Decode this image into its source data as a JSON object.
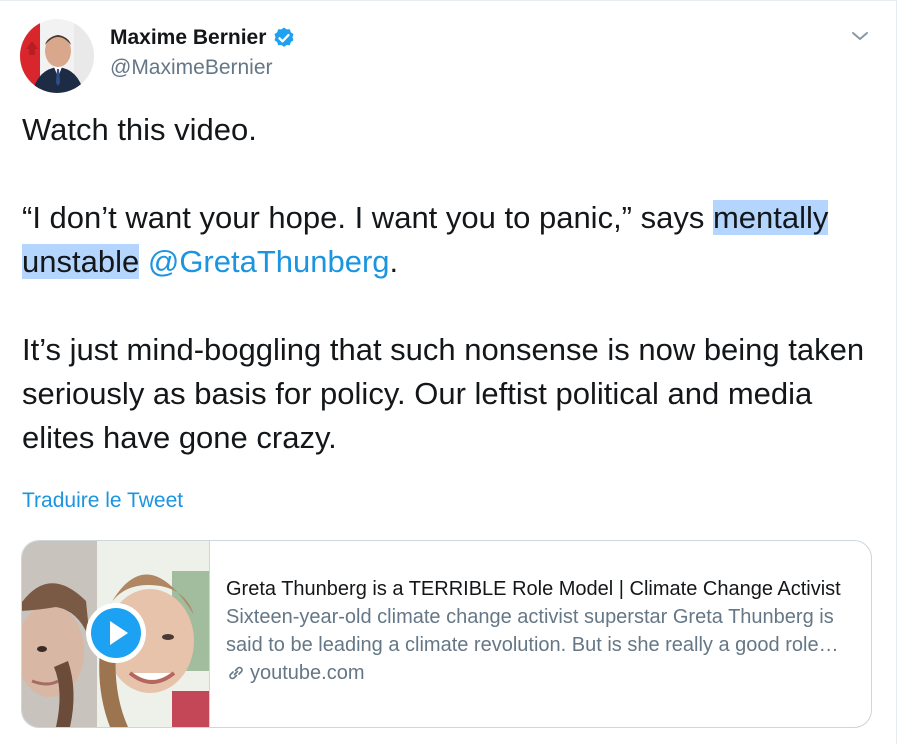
{
  "author": {
    "display_name": "Maxime Bernier",
    "handle": "@MaximeBernier",
    "verified_icon": "verified-badge-icon",
    "menu_icon": "chevron-down-icon"
  },
  "tweet": {
    "line1": "Watch this video.",
    "quote_start": "“I don’t want your hope. I want you to panic,” says ",
    "highlighted": "mentally unstable",
    "space": " ",
    "mention": "@GretaThunberg",
    "quote_end": ".",
    "para3": "It’s just mind-boggling that such nonsense is now being taken seriously as basis for policy. Our leftist political and media elites have gone crazy."
  },
  "translate_label": "Traduire le Tweet",
  "card": {
    "title": "Greta Thunberg is a TERRIBLE Role Model | Climate Change Activist",
    "description": "Sixteen-year-old climate change activist superstar Greta Thunberg is said to be leading a climate revolution. But is she really a good role model?",
    "domain": "youtube.com",
    "play_icon": "play-icon",
    "link_icon": "link-icon"
  },
  "colors": {
    "link": "#1b95e0",
    "muted": "#657786",
    "highlight": "#b4d5fe",
    "border": "#ccd6dd"
  }
}
